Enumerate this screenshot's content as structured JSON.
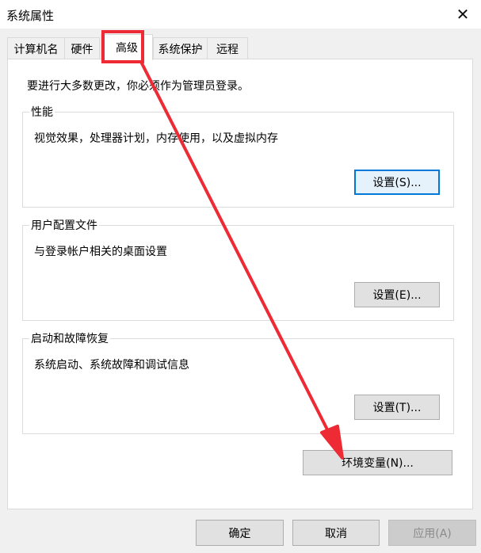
{
  "window": {
    "title": "系统属性",
    "close_glyph": "✕"
  },
  "tabs": [
    {
      "label": "计算机名",
      "active": false
    },
    {
      "label": "硬件",
      "active": false
    },
    {
      "label": "高级",
      "active": true
    },
    {
      "label": "系统保护",
      "active": false
    },
    {
      "label": "远程",
      "active": false
    }
  ],
  "notice": "要进行大多数更改，你必须作为管理员登录。",
  "groups": {
    "performance": {
      "title": "性能",
      "desc": "视觉效果，处理器计划，内存使用，以及虚拟内存",
      "button": "设置(S)..."
    },
    "profiles": {
      "title": "用户配置文件",
      "desc": "与登录帐户相关的桌面设置",
      "button": "设置(E)..."
    },
    "startup": {
      "title": "启动和故障恢复",
      "desc": "系统启动、系统故障和调试信息",
      "button": "设置(T)..."
    }
  },
  "env_button": "环境变量(N)...",
  "footer": {
    "ok": "确定",
    "cancel": "取消",
    "apply": "应用(A)"
  },
  "colors": {
    "highlight": "#ee2b35",
    "focus": "#0078d7"
  }
}
